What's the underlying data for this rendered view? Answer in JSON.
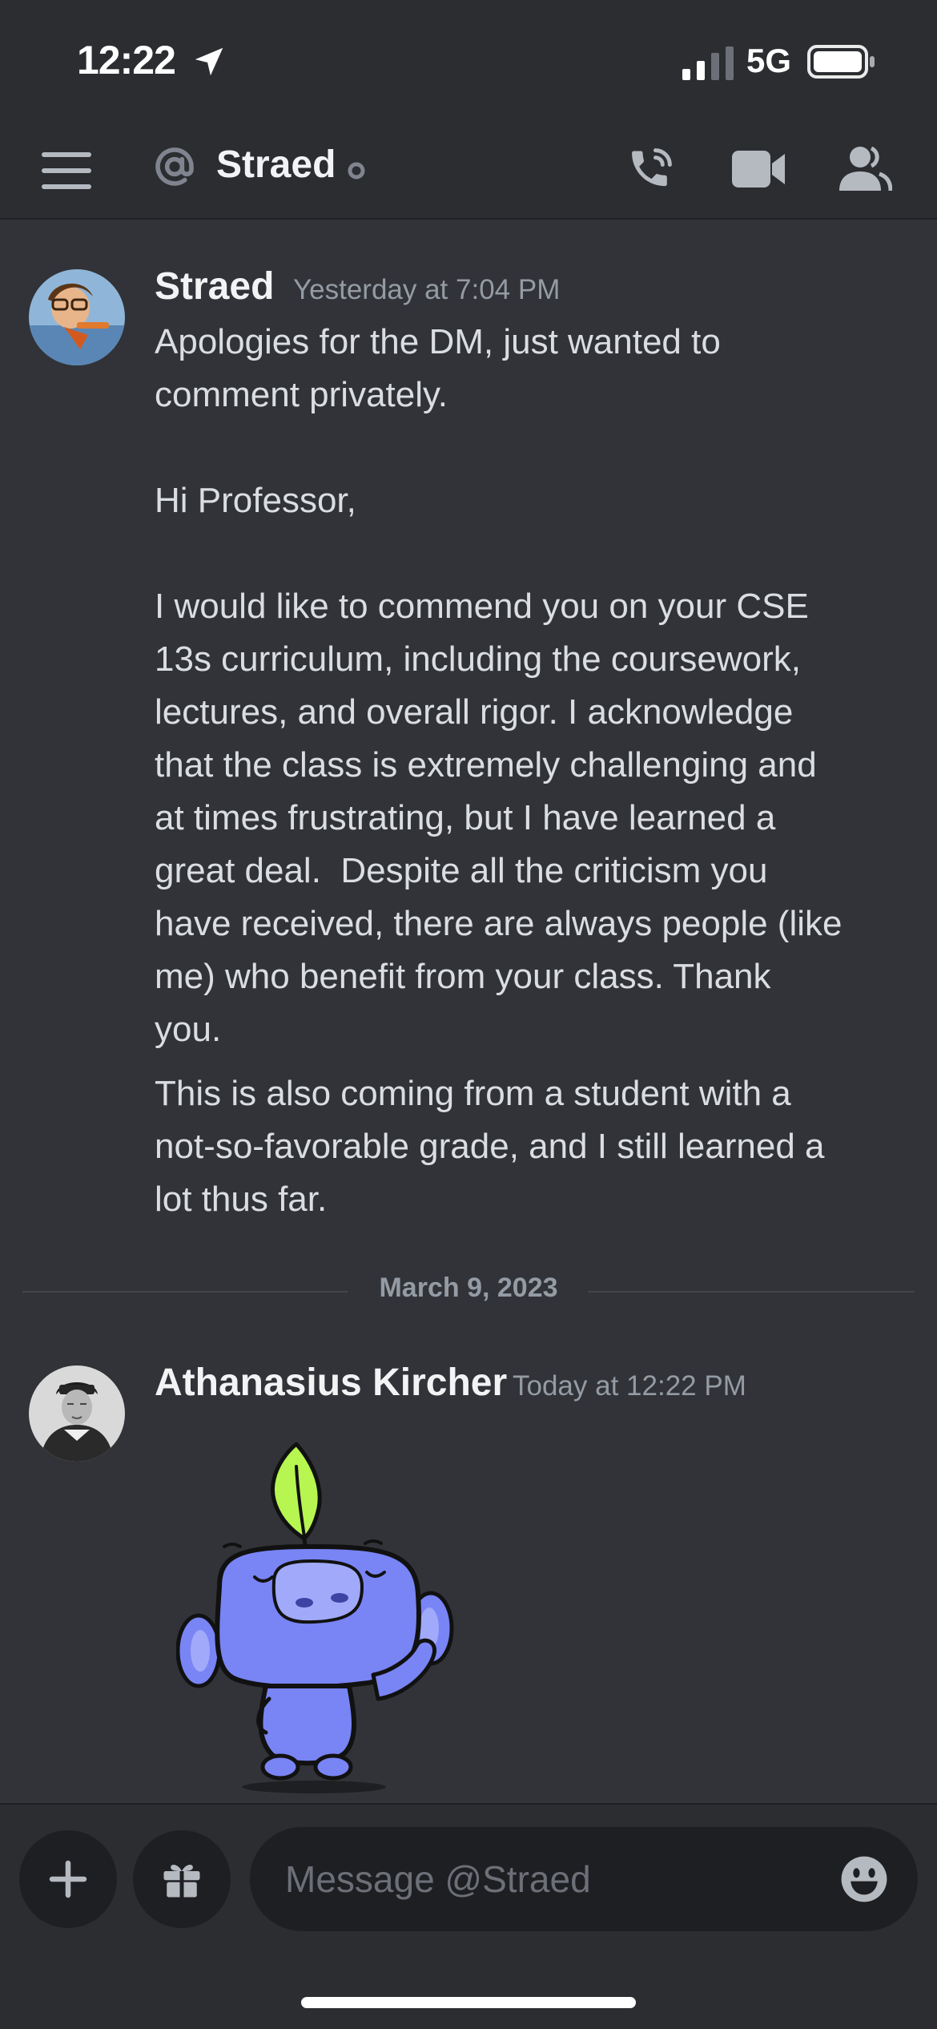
{
  "status_bar": {
    "time": "12:22",
    "network": "5G"
  },
  "header": {
    "title": "Straed",
    "icons": [
      "menu-icon",
      "at-icon",
      "status-dot",
      "call-icon",
      "video-icon",
      "members-icon"
    ]
  },
  "messages": [
    {
      "author": "Straed",
      "timestamp": "Yesterday at 7:04 PM",
      "paragraph_1": "Apologies for the DM, just wanted to\ncomment privately.\n\nHi Professor,\n\nI would like to commend you on your CSE\n13s curriculum, including the coursework,\nlectures, and overall rigor. I acknowledge\nthat the class is extremely challenging and\nat times frustrating, but I have learned a\ngreat deal.  Despite all the criticism you\nhave received, there are always people (like\nme) who benefit from your class. Thank\nyou.",
      "paragraph_2": "This is also coming from a student with a\nnot-so-favorable grade, and I still learned a\nlot thus far."
    },
    {
      "author": "Athanasius Kircher",
      "timestamp": "Today at 12:22 PM",
      "sticker": "wumpus-sticker"
    }
  ],
  "date_divider": "March 9, 2023",
  "input": {
    "placeholder": "Message @Straed"
  },
  "colors": {
    "background": "#313338",
    "bar": "#2b2d31",
    "input": "#1e1f22",
    "blurple": "#7984f5",
    "leaf": "#b7f550"
  }
}
